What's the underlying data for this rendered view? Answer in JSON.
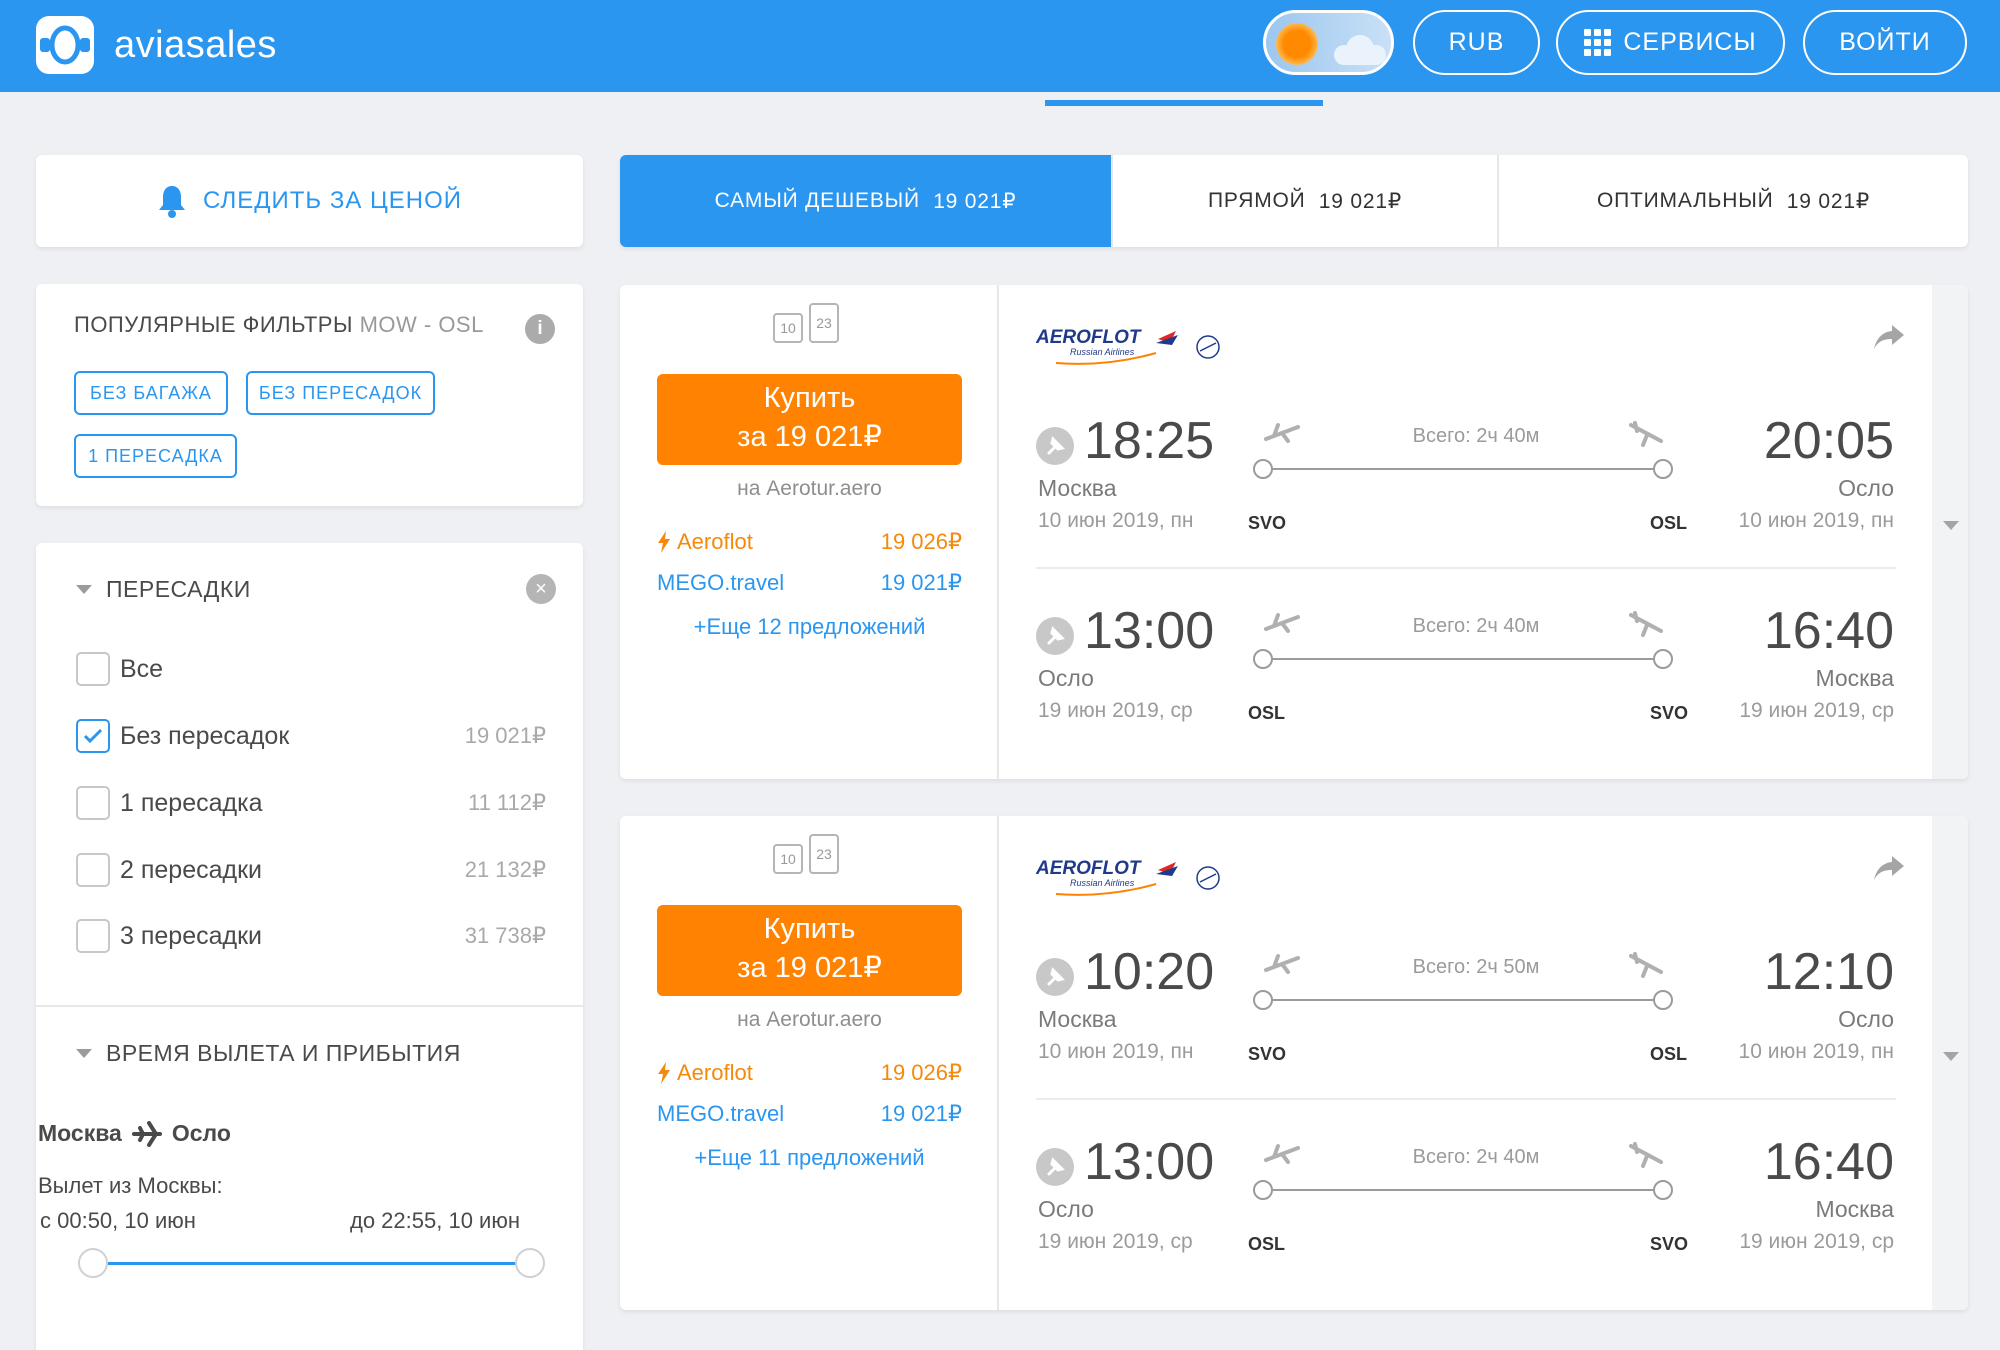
{
  "header": {
    "logo_text": "aviasales",
    "currency_label": "RUB",
    "services_label": "СЕРВИСЫ",
    "login_label": "ВОЙТИ"
  },
  "sidebar": {
    "track_price_label": "СЛЕДИТЬ ЗА ЦЕНОЙ",
    "popular_filters": {
      "title": "ПОПУЛЯРНЫЕ ФИЛЬТРЫ",
      "route": "MOW - OSL",
      "info_icon": "i",
      "tags": [
        "БЕЗ БАГАЖА",
        "БЕЗ ПЕРЕСАДОК",
        "1 ПЕРЕСАДКА"
      ]
    },
    "stops": {
      "title": "ПЕРЕСАДКИ",
      "clear_icon": "×",
      "options": [
        {
          "label": "Все",
          "price": "",
          "checked": false
        },
        {
          "label": "Без пересадок",
          "price": "19 021₽",
          "checked": true
        },
        {
          "label": "1 пересадка",
          "price": "11 112₽",
          "checked": false
        },
        {
          "label": "2 пересадки",
          "price": "21 132₽",
          "checked": false
        },
        {
          "label": "3 пересадки",
          "price": "31 738₽",
          "checked": false
        }
      ]
    },
    "times": {
      "title": "ВРЕМЯ ВЫЛЕТА И ПРИБЫТИЯ",
      "route_from": "Москва",
      "route_to": "Осло",
      "departure_label": "Вылет из Москвы:",
      "range_from": "с 00:50, 10 июн",
      "range_to": "до 22:55, 10 июн",
      "range_fraction": [
        0.0,
        1.0
      ]
    }
  },
  "sort_tabs": [
    {
      "label": "САМЫЙ ДЕШЕВЫЙ",
      "price": "19 021₽",
      "active": true
    },
    {
      "label": "ПРЯМОЙ",
      "price": "19 021₽",
      "active": false
    },
    {
      "label": "ОПТИМАЛЬНЫЙ",
      "price": "19 021₽",
      "active": false
    }
  ],
  "tickets": [
    {
      "baggage": {
        "hand": "10",
        "checked": "23"
      },
      "buy_label": "Купить",
      "buy_price": "за 19 021₽",
      "seller": "на Aerotur.aero",
      "agents": [
        {
          "name": "Aeroflot",
          "price": "19 026₽",
          "highlight": true
        },
        {
          "name": "MEGO.travel",
          "price": "19 021₽",
          "highlight": false
        }
      ],
      "more_offers": "+Еще 12 предложений",
      "airline": {
        "name": "AEROFLOT",
        "subtitle": "Russian Airlines"
      },
      "segments": [
        {
          "dep_time": "18:25",
          "arr_time": "20:05",
          "dep_city": "Москва",
          "arr_city": "Осло",
          "dep_date": "10 июн 2019, пн",
          "arr_date": "10 июн 2019, пн",
          "dep_code": "SVO",
          "arr_code": "OSL",
          "duration": "Всего: 2ч 40м"
        },
        {
          "dep_time": "13:00",
          "arr_time": "16:40",
          "dep_city": "Осло",
          "arr_city": "Москва",
          "dep_date": "19 июн 2019, ср",
          "arr_date": "19 июн 2019, ср",
          "dep_code": "OSL",
          "arr_code": "SVO",
          "duration": "Всего: 2ч 40м"
        }
      ]
    },
    {
      "baggage": {
        "hand": "10",
        "checked": "23"
      },
      "buy_label": "Купить",
      "buy_price": "за 19 021₽",
      "seller": "на Aerotur.aero",
      "agents": [
        {
          "name": "Aeroflot",
          "price": "19 026₽",
          "highlight": true
        },
        {
          "name": "MEGO.travel",
          "price": "19 021₽",
          "highlight": false
        }
      ],
      "more_offers": "+Еще 11 предложений",
      "airline": {
        "name": "AEROFLOT",
        "subtitle": "Russian Airlines"
      },
      "segments": [
        {
          "dep_time": "10:20",
          "arr_time": "12:10",
          "dep_city": "Москва",
          "arr_city": "Осло",
          "dep_date": "10 июн 2019, пн",
          "arr_date": "10 июн 2019, пн",
          "dep_code": "SVO",
          "arr_code": "OSL",
          "duration": "Всего: 2ч 50м"
        },
        {
          "dep_time": "13:00",
          "arr_time": "16:40",
          "dep_city": "Осло",
          "arr_city": "Москва",
          "dep_date": "19 июн 2019, ср",
          "arr_date": "19 июн 2019, ср",
          "dep_code": "OSL",
          "arr_code": "SVO",
          "duration": "Всего: 2ч 40м"
        }
      ]
    }
  ],
  "colors": {
    "brand_blue": "#2b96f0",
    "buy_orange": "#ff8200",
    "agent_orange": "#f5890b",
    "agent_blue": "#2b96f0"
  },
  "icons": {
    "logo": "aviasales-logo-icon",
    "theme": "sun-cloud-toggle-icon",
    "services": "grid-icon",
    "bell": "bell-icon",
    "info": "info-icon",
    "clear": "close-circle-icon",
    "checkbox": "checkmark-icon",
    "plane": "plane-icon",
    "pin": "pin-icon",
    "share": "share-arrow-icon",
    "baggage": "baggage-icon",
    "lightning": "lightning-icon"
  }
}
